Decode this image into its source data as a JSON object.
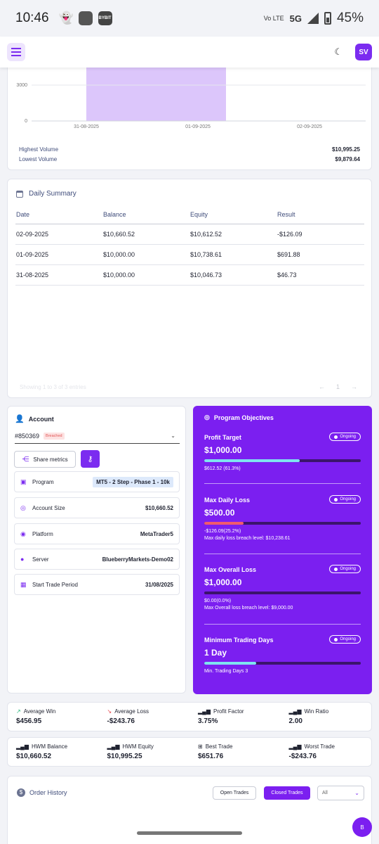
{
  "status": {
    "time": "10:46",
    "net": "5G",
    "volte": "Vo LTE",
    "battery": "45%",
    "bybit": "BYBIT"
  },
  "header": {
    "avatar": "SV"
  },
  "volume": {
    "chart_data": {
      "type": "bar",
      "categories": [
        "31-08-2025",
        "01-09-2025",
        "02-09-2025"
      ],
      "y_ticks": [
        0,
        3000
      ],
      "highlight_range": [
        "31-08-2025",
        "01-09-2025"
      ],
      "bar_color": "#dcc6fb"
    },
    "highest_label": "Highest Volume",
    "highest_value": "$10,995.25",
    "lowest_label": "Lowest Volume",
    "lowest_value": "$9,879.64"
  },
  "daily": {
    "title": "Daily Summary",
    "columns": [
      "Date",
      "Balance",
      "Equity",
      "Result"
    ],
    "rows": [
      [
        "02-09-2025",
        "$10,660.52",
        "$10,612.52",
        "-$126.09"
      ],
      [
        "01-09-2025",
        "$10,000.00",
        "$10,738.61",
        "$691.88"
      ],
      [
        "31-08-2025",
        "$10,000.00",
        "$10,046.73",
        "$46.73"
      ]
    ],
    "footer": "Showing 1 to 3 of 3 entries",
    "page": "1"
  },
  "account": {
    "title": "Account",
    "number": "#850369",
    "badge": "Breached",
    "share_label": "Share metrics",
    "rows": [
      {
        "icon": "briefcase",
        "label": "Program",
        "value": "MT5 - 2 Step - Phase 1 - 10k"
      },
      {
        "icon": "coins",
        "label": "Account Size",
        "value": "$10,660.52"
      },
      {
        "icon": "target",
        "label": "Platform",
        "value": "MetaTrader5"
      },
      {
        "icon": "clock",
        "label": "Server",
        "value": "BlueberryMarkets-Demo02"
      },
      {
        "icon": "calendar",
        "label": "Start Trade Period",
        "value": "31/08/2025"
      }
    ]
  },
  "objectives": {
    "title": "Program Objectives",
    "status": "Ongoing",
    "items": [
      {
        "name": "Profit Target",
        "amount": "$1,000.00",
        "progress": 0.61,
        "color": "#7fe3f0",
        "sub1": "$612.52 (61.3%)",
        "sub2": ""
      },
      {
        "name": "Max Daily Loss",
        "amount": "$500.00",
        "progress": 0.25,
        "color": "#f15b6c",
        "sub1": "-$126.09(25.2%)",
        "sub2": "Max daily loss breach level: $10,238.61"
      },
      {
        "name": "Max Overall Loss",
        "amount": "$1,000.00",
        "progress": 0.0,
        "color": "#f15b6c",
        "sub1": "$0.00(0.0%)",
        "sub2": "Max Overall loss breach level: $9,000.00"
      },
      {
        "name": "Minimum Trading Days",
        "amount": "1 Day",
        "progress": 0.33,
        "color": "#7fe3f0",
        "sub1": "Min. Trading Days 3",
        "sub2": ""
      }
    ]
  },
  "stats1": [
    {
      "label": "Average Win",
      "value": "$456.95"
    },
    {
      "label": "Average Loss",
      "value": "-$243.76"
    },
    {
      "label": "Profit Factor",
      "value": "3.75%"
    },
    {
      "label": "Win Ratio",
      "value": "2.00"
    }
  ],
  "stats2": [
    {
      "label": "HWM Balance",
      "value": "$10,660.52"
    },
    {
      "label": "HWM Equity",
      "value": "$10,995.25"
    },
    {
      "label": "Best Trade",
      "value": "$651.76"
    },
    {
      "label": "Worst Trade",
      "value": "-$243.76"
    }
  ],
  "orders": {
    "title": "Order History",
    "open_label": "Open Trades",
    "closed_label": "Closed Trades",
    "filter": "All"
  },
  "fab": "B"
}
